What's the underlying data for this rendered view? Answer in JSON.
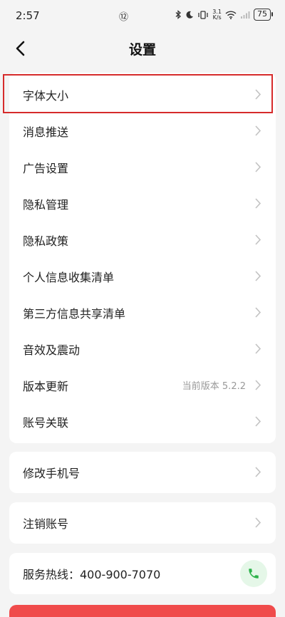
{
  "status_bar": {
    "time": "2:57",
    "center_glyph": "⑫",
    "network_speed_value": "3.1",
    "network_speed_unit": "K/s",
    "battery": "75"
  },
  "header": {
    "title": "设置"
  },
  "settings": {
    "items": [
      {
        "label": "字体大小"
      },
      {
        "label": "消息推送"
      },
      {
        "label": "广告设置"
      },
      {
        "label": "隐私管理"
      },
      {
        "label": "隐私政策"
      },
      {
        "label": "个人信息收集清单"
      },
      {
        "label": "第三方信息共享清单"
      },
      {
        "label": "音效及震动"
      },
      {
        "label": "版本更新",
        "value": "当前版本 5.2.2"
      },
      {
        "label": "账号关联"
      }
    ]
  },
  "account": {
    "change_phone": "修改手机号",
    "cancel_account": "注销账号"
  },
  "service": {
    "hotline": "服务热线：400-900-7070"
  },
  "colors": {
    "highlight": "#d62b2b",
    "phone_accent": "#2db24a",
    "bottom_button": "#f04b4b"
  }
}
